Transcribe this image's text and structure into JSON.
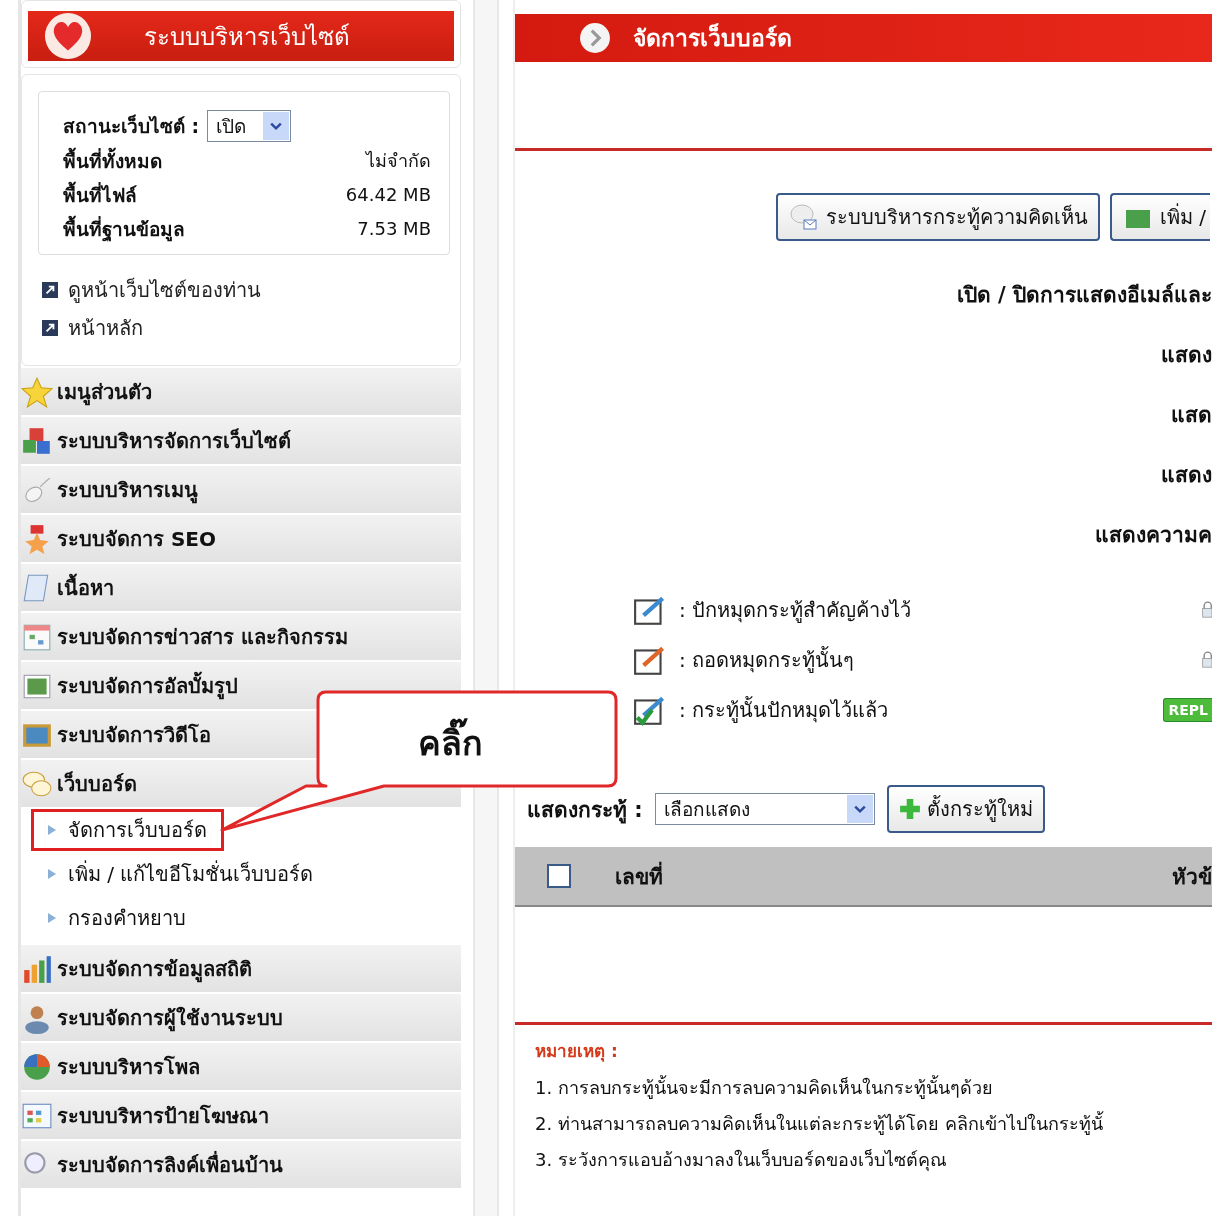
{
  "sidebar": {
    "title": "ระบบบริหารเว็บไซต์",
    "status": {
      "label": "สถานะเว็บไซต์ :",
      "value": "เปิด"
    },
    "stats": [
      {
        "label": "พื้นที่ทั้งหมด",
        "value": "ไม่จำกัด"
      },
      {
        "label": "พื้นที่ไฟล์",
        "value": "64.42 MB"
      },
      {
        "label": "พื้นที่ฐานข้อมูล",
        "value": "7.53 MB"
      }
    ],
    "links": [
      "ดูหน้าเว็บไซต์ของท่าน",
      "หน้าหลัก"
    ],
    "menu": [
      {
        "label": "เมนูส่วนตัว",
        "kind": "star"
      },
      {
        "label": "ระบบบริหารจัดการเว็บไซต์",
        "kind": "cubes"
      },
      {
        "label": "ระบบบริหารเมนู",
        "kind": "mouse"
      },
      {
        "label": "ระบบจัดการ SEO",
        "kind": "medal"
      },
      {
        "label": "เนื้อหา",
        "kind": "document"
      },
      {
        "label": "ระบบจัดการข่าวสาร และกิจกรรม",
        "kind": "calendar"
      },
      {
        "label": "ระบบจัดการอัลบั้มรูป",
        "kind": "photo"
      },
      {
        "label": "ระบบจัดการวิดีโอ",
        "kind": "video"
      },
      {
        "label": "เว็บบอร์ด",
        "kind": "chat",
        "children": [
          {
            "label": "จัดการเว็บบอร์ด",
            "selected": true
          },
          {
            "label": "เพิ่ม / แก้ไขอีโมชั่นเว็บบอร์ด",
            "selected": false
          },
          {
            "label": "กรองคำหยาบ",
            "selected": false
          }
        ]
      },
      {
        "label": "ระบบจัดการข้อมูลสถิติ",
        "kind": "chart"
      },
      {
        "label": "ระบบจัดการผู้ใช้งานระบบ",
        "kind": "user"
      },
      {
        "label": "ระบบบริหารโพล",
        "kind": "pie"
      },
      {
        "label": "ระบบบริหารป้ายโฆษณา",
        "kind": "board"
      },
      {
        "label": "ระบบจัดการลิงค์เพื่อนบ้าน",
        "kind": "search"
      }
    ]
  },
  "main": {
    "title": "จัดการเว็บบอร์ด",
    "buttons": [
      {
        "label": "ระบบบริหารกระทู้ความคิดเห็น",
        "kind": "comment"
      },
      {
        "label": "เพิ่ม /",
        "kind": "folder"
      }
    ],
    "settings": [
      "เปิด / ปิดการแสดงอีเมล์และ",
      "แสดง",
      "แสด",
      "แสดง",
      "แสดงความค"
    ],
    "legend": [
      {
        "kind": "pin",
        "text": ": ปักหมุดกระทู้สำคัญค้างไว้"
      },
      {
        "kind": "unpin",
        "text": ": ถอดหมุดกระทู้นั้นๆ"
      },
      {
        "kind": "pinned",
        "text": ": กระทู้นั้นปักหมุดไว้แล้ว",
        "badge": "REPL"
      }
    ],
    "show_topics": {
      "label": "แสดงกระทู้ :",
      "value": "เลือกแสดง"
    },
    "new_topic_button": "ตั้งกระทู้ใหม่",
    "table": {
      "select_all_checked": false,
      "columns": [
        "เลขที่",
        "หัวข้"
      ]
    },
    "notes": {
      "title": "หมายเหตุ :",
      "items": [
        "1. การลบกระทู้นั้นจะมีการลบความคิดเห็นในกระทู้นั้นๆด้วย",
        "2. ท่านสามารถลบความคิดเห็นในแต่ละกระทู้ได้โดย คลิกเข้าไปในกระทู้นั้",
        "3. ระวังการแอบอ้างมาลงในเว็บบอร์ดของเว็บไซต์คุณ"
      ]
    }
  },
  "annotation": {
    "text": "คลิ๊ก"
  }
}
